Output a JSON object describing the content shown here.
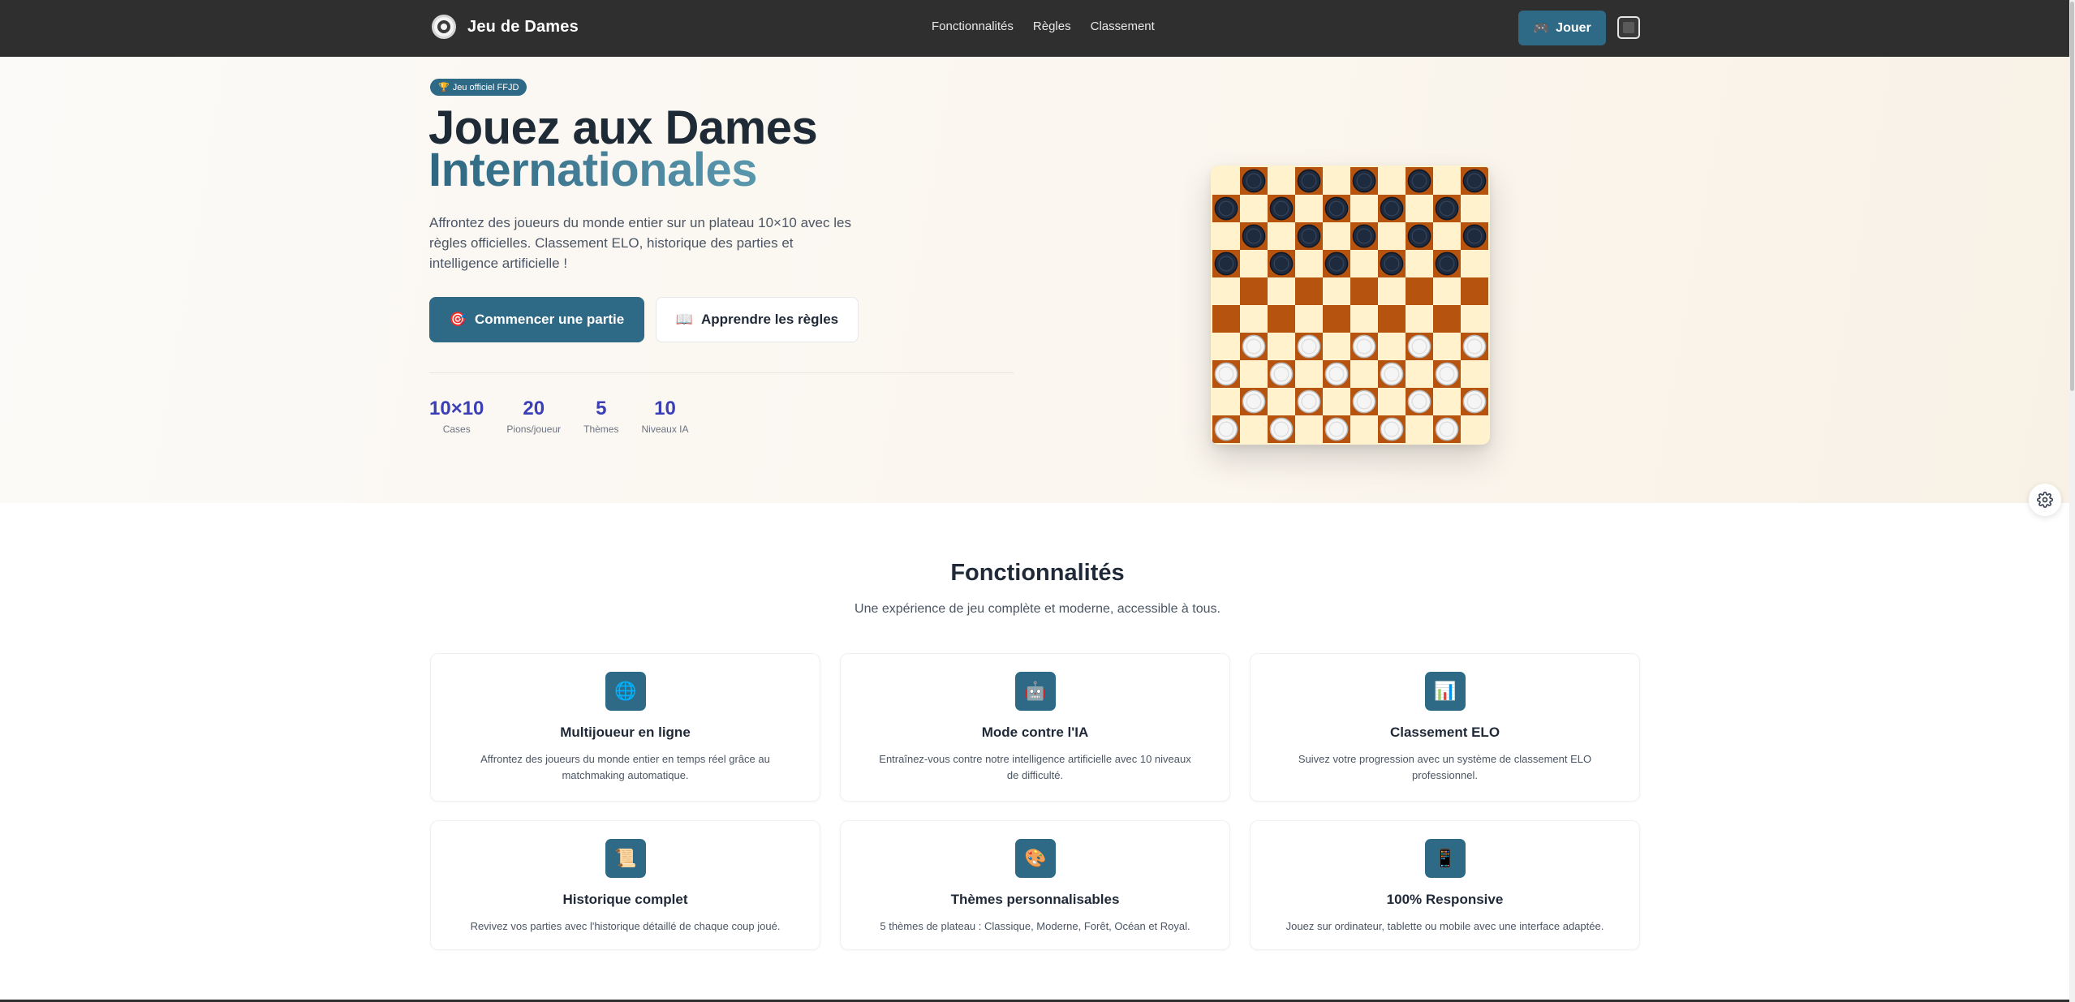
{
  "nav": {
    "brand": "Jeu de Dames",
    "links": [
      "Fonctionnalités",
      "Règles",
      "Classement"
    ],
    "play_label": "Jouer",
    "play_icon": "🎮"
  },
  "hero": {
    "badge_icon": "🏆",
    "badge": "Jeu officiel FFJD",
    "title_line1": "Jouez aux Dames",
    "title_line2": "Internationales",
    "description": "Affrontez des joueurs du monde entier sur un plateau 10×10 avec les règles officielles. Classement ELO, historique des parties et intelligence artificielle !",
    "start_icon": "🎯",
    "start_label": "Commencer une partie",
    "rules_icon": "📖",
    "rules_label": "Apprendre les règles",
    "stats": [
      {
        "value": "10×10",
        "label": "Cases"
      },
      {
        "value": "20",
        "label": "Pions/joueur"
      },
      {
        "value": "5",
        "label": "Thèmes"
      },
      {
        "value": "10",
        "label": "Niveaux IA"
      }
    ]
  },
  "board": {
    "size": 10,
    "light_square": "#fff2cc",
    "dark_square": "#b5530f",
    "dark_piece_rows": [
      0,
      1,
      2,
      3
    ],
    "light_piece_rows": [
      6,
      7,
      8,
      9
    ],
    "dark_piece_color": "#1e2a3d",
    "light_piece_color": "#f5f5f5"
  },
  "features": {
    "title": "Fonctionnalités",
    "subtitle": "Une expérience de jeu complète et moderne, accessible à tous.",
    "cards": [
      {
        "icon": "🌐",
        "icon_name": "globe-icon",
        "title": "Multijoueur en ligne",
        "desc": "Affrontez des joueurs du monde entier en temps réel grâce au matchmaking automatique."
      },
      {
        "icon": "🤖",
        "icon_name": "robot-icon",
        "title": "Mode contre l'IA",
        "desc": "Entraînez-vous contre notre intelligence artificielle avec 10 niveaux de difficulté."
      },
      {
        "icon": "📊",
        "icon_name": "chart-icon",
        "title": "Classement ELO",
        "desc": "Suivez votre progression avec un système de classement ELO professionnel."
      },
      {
        "icon": "📜",
        "icon_name": "scroll-icon",
        "title": "Historique complet",
        "desc": "Revivez vos parties avec l'historique détaillé de chaque coup joué."
      },
      {
        "icon": "🎨",
        "icon_name": "palette-icon",
        "title": "Thèmes personnalisables",
        "desc": "5 thèmes de plateau : Classique, Moderne, Forêt, Océan et Royal."
      },
      {
        "icon": "📱",
        "icon_name": "mobile-icon",
        "title": "100% Responsive",
        "desc": "Jouez sur ordinateur, tablette ou mobile avec une interface adaptée."
      }
    ]
  },
  "colors": {
    "accent": "#2e6a86",
    "navbar": "#2f2f2f",
    "stat": "#3b3fb5"
  }
}
